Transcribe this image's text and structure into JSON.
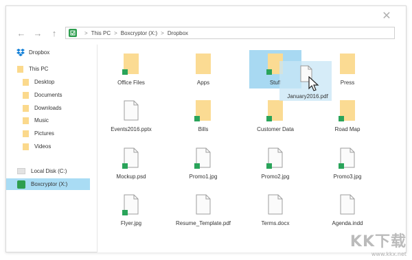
{
  "breadcrumb": {
    "items": [
      "This PC",
      "Boxcryptor (X:)",
      "Dropbox"
    ]
  },
  "sidebar": {
    "items": [
      {
        "label": "Dropbox",
        "icon": "dropbox-icon"
      },
      {
        "label": "This PC",
        "icon": "folder-icon"
      },
      {
        "label": "Desktop",
        "icon": "folder-icon"
      },
      {
        "label": "Documents",
        "icon": "folder-icon"
      },
      {
        "label": "Downloads",
        "icon": "folder-icon"
      },
      {
        "label": "Music",
        "icon": "folder-icon"
      },
      {
        "label": "Pictures",
        "icon": "folder-icon"
      },
      {
        "label": "Videos",
        "icon": "folder-icon"
      },
      {
        "label": "Local Disk (C:)",
        "icon": "drive-icon"
      },
      {
        "label": "Boxcryptor (X:)",
        "icon": "boxcryptor-icon",
        "selected": true
      }
    ]
  },
  "files": [
    {
      "label": "Office Files",
      "type": "folder",
      "encrypted": true
    },
    {
      "label": "Apps",
      "type": "folder",
      "encrypted": false
    },
    {
      "label": "Stuff",
      "type": "folder",
      "encrypted": true,
      "selected": true
    },
    {
      "label": "Press",
      "type": "folder",
      "encrypted": false
    },
    {
      "label": "Events2016.pptx",
      "type": "file",
      "encrypted": false
    },
    {
      "label": "Bills",
      "type": "folder",
      "encrypted": true
    },
    {
      "label": "Customer Data",
      "type": "folder",
      "encrypted": true
    },
    {
      "label": "Road Map",
      "type": "folder",
      "encrypted": true
    },
    {
      "label": "Mockup.psd",
      "type": "file",
      "encrypted": true
    },
    {
      "label": "Promo1.jpg",
      "type": "file",
      "encrypted": true
    },
    {
      "label": "Promo2.jpg",
      "type": "file",
      "encrypted": true
    },
    {
      "label": "Promo3.jpg",
      "type": "file",
      "encrypted": true
    },
    {
      "label": "Flyer.jpg",
      "type": "file",
      "encrypted": true
    },
    {
      "label": "Resume_Template.pdf",
      "type": "file",
      "encrypted": false
    },
    {
      "label": "Terms.docx",
      "type": "file",
      "encrypted": false
    },
    {
      "label": "Agenda.indd",
      "type": "file",
      "encrypted": false
    }
  ],
  "drag": {
    "label": "January2016.pdf"
  },
  "watermark": {
    "text": "KK下载",
    "url": "www.kkx.net"
  },
  "colors": {
    "encrypted_badge": "#2aa45a",
    "folder": "#fbdb93",
    "selection": "#a8d9f2",
    "boxcryptor_green": "#2e9e4f"
  }
}
